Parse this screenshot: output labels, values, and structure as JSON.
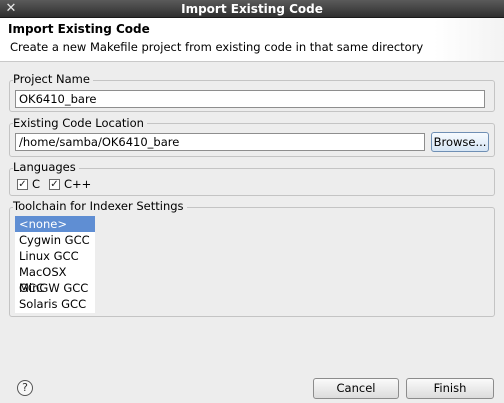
{
  "window": {
    "title": "Import Existing Code",
    "close_glyph": "✕"
  },
  "header": {
    "title": "Import Existing Code",
    "description": "Create a new Makefile project from existing code in that same directory"
  },
  "project_name": {
    "label": "Project Name",
    "value": "OK6410_bare"
  },
  "code_location": {
    "label": "Existing Code Location",
    "value": "/home/samba/OK6410_bare",
    "browse_label": "Browse..."
  },
  "languages": {
    "label": "Languages",
    "items": [
      {
        "label": "C",
        "checked": true
      },
      {
        "label": "C++",
        "checked": true
      }
    ]
  },
  "toolchain": {
    "label": "Toolchain for Indexer Settings",
    "items": [
      "<none>",
      "Cygwin GCC",
      "Linux GCC",
      "MacOSX GCC",
      "MinGW GCC",
      "Solaris GCC"
    ],
    "selected": "<none>"
  },
  "footer": {
    "cancel_label": "Cancel",
    "finish_label": "Finish",
    "help_glyph": "?"
  }
}
